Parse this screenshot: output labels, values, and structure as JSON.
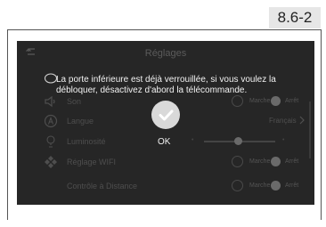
{
  "page_number": "8.6-2",
  "screen": {
    "title": "Réglages",
    "rows": [
      {
        "label": "Son",
        "on_label": "Marche",
        "off_label": "Arrêt"
      },
      {
        "label": "Langue",
        "value": "Français"
      },
      {
        "label": "Luminosité"
      },
      {
        "label": "Réglage WIFI",
        "on_label": "Marche",
        "off_label": "Arrêt"
      },
      {
        "label": "Contrôle à Distance",
        "on_label": "Marche",
        "off_label": "Arrêt"
      }
    ]
  },
  "dialog": {
    "message": "La porte inférieure est déjà verrouillée, si vous voulez la débloquer, désactivez d'abord la télécommande.",
    "ok_label": "OK"
  }
}
